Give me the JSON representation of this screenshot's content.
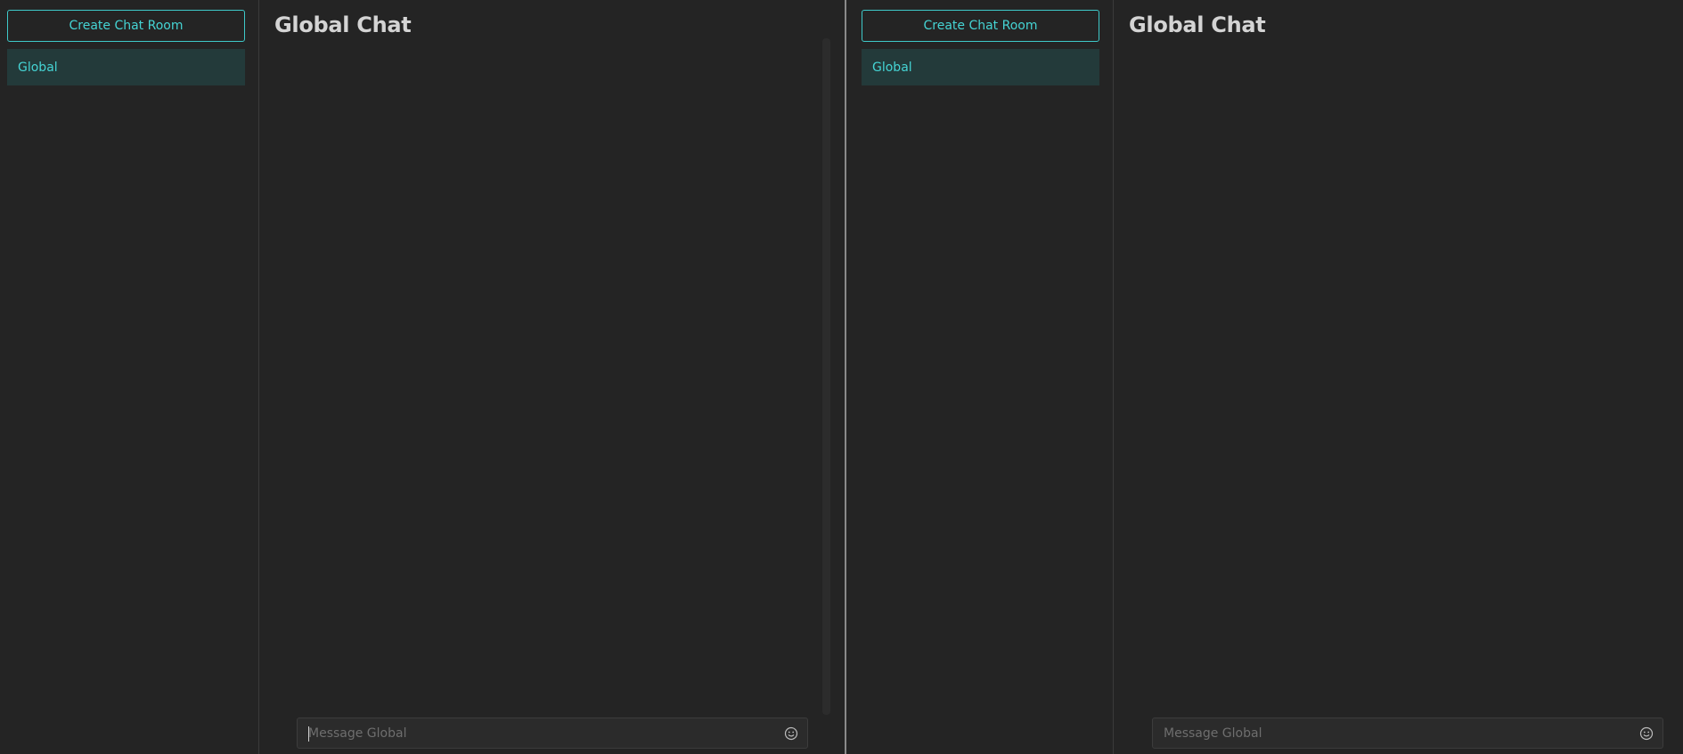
{
  "panes": [
    {
      "sidebar": {
        "create_button": "Create Chat Room",
        "rooms": [
          {
            "label": "Global",
            "active": true
          }
        ]
      },
      "main": {
        "title": "Global Chat",
        "composer": {
          "placeholder": "Message Global",
          "value": ""
        },
        "emoji_icon": "smiley-face-icon"
      }
    },
    {
      "sidebar": {
        "create_button": "Create Chat Room",
        "rooms": [
          {
            "label": "Global",
            "active": true
          }
        ]
      },
      "main": {
        "title": "Global Chat",
        "composer": {
          "placeholder": "Message Global",
          "value": ""
        },
        "emoji_icon": "smiley-face-icon"
      }
    }
  ],
  "colors": {
    "background": "#242424",
    "accent": "#45d4d4",
    "active_room_bg": "#233a3a",
    "title_text": "#d4d4d4"
  }
}
